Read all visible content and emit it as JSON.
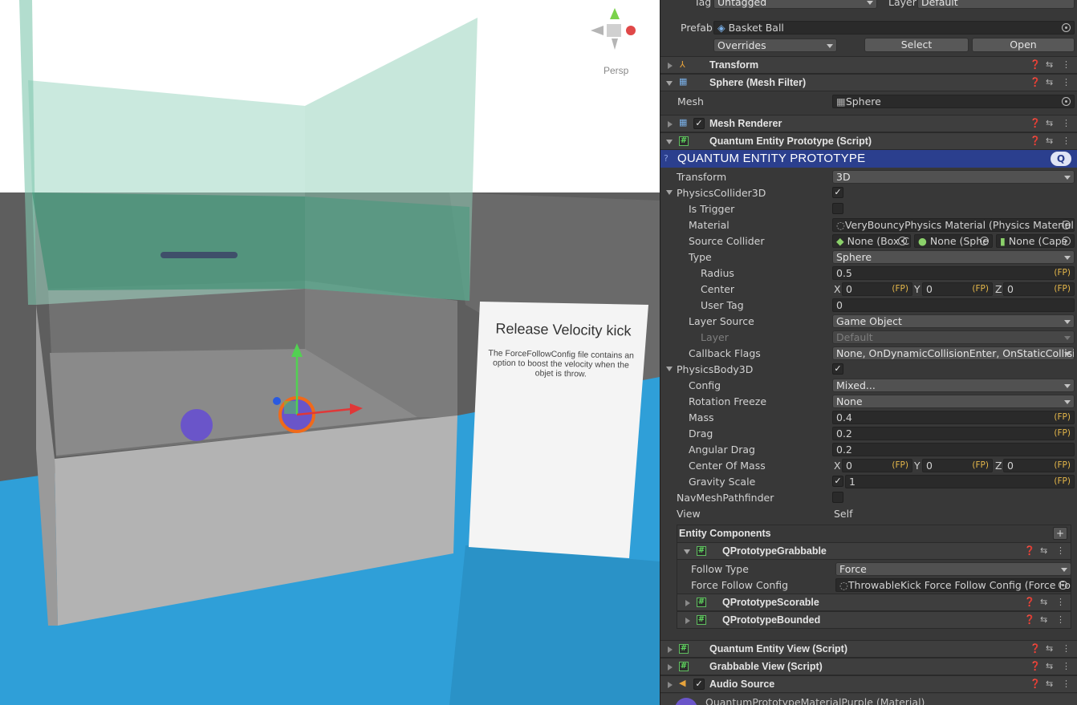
{
  "scene": {
    "view_label": "Persp",
    "sign_title": "Release Velocity kick",
    "sign_body": "The ForceFollowConfig file contains an option to boost the velocity when the objet is throw.",
    "icons": [
      "scene-gizmo-icon",
      "move-tool-arrows-icon",
      "purple-ball",
      "selected-ball"
    ]
  },
  "header": {
    "tag_label": "Tag",
    "tag_value": "Untagged",
    "layer_label": "Layer",
    "layer_value": "Default",
    "prefab_label": "Prefab",
    "prefab_value": "Basket Ball",
    "overrides": "Overrides",
    "select": "Select",
    "open": "Open"
  },
  "components": {
    "transform": "Transform",
    "mesh_filter": "Sphere (Mesh Filter)",
    "mesh_label": "Mesh",
    "mesh_value": "Sphere",
    "mesh_renderer": "Mesh Renderer",
    "quantum_proto": "Quantum Entity Prototype (Script)"
  },
  "quantum": {
    "banner": "QUANTUM ENTITY PROTOTYPE",
    "fields": [
      {
        "label": "Transform",
        "value": "3D"
      },
      {
        "label": "PhysicsCollider3D"
      },
      {
        "label": "Is Trigger"
      },
      {
        "label": "Material",
        "value": "VeryBouncyPhysics Material (Physics Material)"
      },
      {
        "label": "Source Collider",
        "v1": "None (Box C",
        "v2": "None (Sphe",
        "v3": "None (Caps"
      },
      {
        "label": "Type",
        "value": "Sphere"
      },
      {
        "label": "Radius",
        "value": "0.5"
      },
      {
        "label": "Center",
        "x": "0",
        "y": "0",
        "z": "0"
      },
      {
        "label": "User Tag",
        "value": "0"
      },
      {
        "label": "Layer Source",
        "value": "Game Object"
      },
      {
        "label": "Layer",
        "value": "Default"
      },
      {
        "label": "Callback Flags",
        "value": "None, OnDynamicCollisionEnter, OnStaticCollision"
      },
      {
        "label": "PhysicsBody3D"
      },
      {
        "label": "Config",
        "value": "Mixed..."
      },
      {
        "label": "Rotation Freeze",
        "value": "None"
      },
      {
        "label": "Mass",
        "value": "0.4"
      },
      {
        "label": "Drag",
        "value": "0.2"
      },
      {
        "label": "Angular Drag",
        "value": "0.2"
      },
      {
        "label": "Center Of Mass",
        "x": "0",
        "y": "0",
        "z": "0"
      },
      {
        "label": "Gravity Scale",
        "value": "1"
      },
      {
        "label": "NavMeshPathfinder"
      },
      {
        "label": "View",
        "value": "Self"
      }
    ],
    "fp": "(FP)",
    "axis_x": "X",
    "axis_y": "Y",
    "axis_z": "Z"
  },
  "entity_components": {
    "title": "Entity Components",
    "grabbable": "QPrototypeGrabbable",
    "follow_type_label": "Follow Type",
    "follow_type_value": "Force",
    "force_cfg_label": "Force Follow Config",
    "force_cfg_value": "ThrowableKick Force Follow Config (Force Fol",
    "scorable": "QPrototypeScorable",
    "bounded": "QPrototypeBounded"
  },
  "more_components": {
    "entity_view": "Quantum Entity View (Script)",
    "grabbable_view": "Grabbable View (Script)",
    "audio_source": "Audio Source",
    "material": "QuantumPrototypeMaterialPurple (Material)"
  },
  "colors": {
    "banner": "#2b3f8e",
    "fp": "#e6b84a",
    "script_icon": "#5fd95f",
    "floor": "#2f9fd8"
  }
}
